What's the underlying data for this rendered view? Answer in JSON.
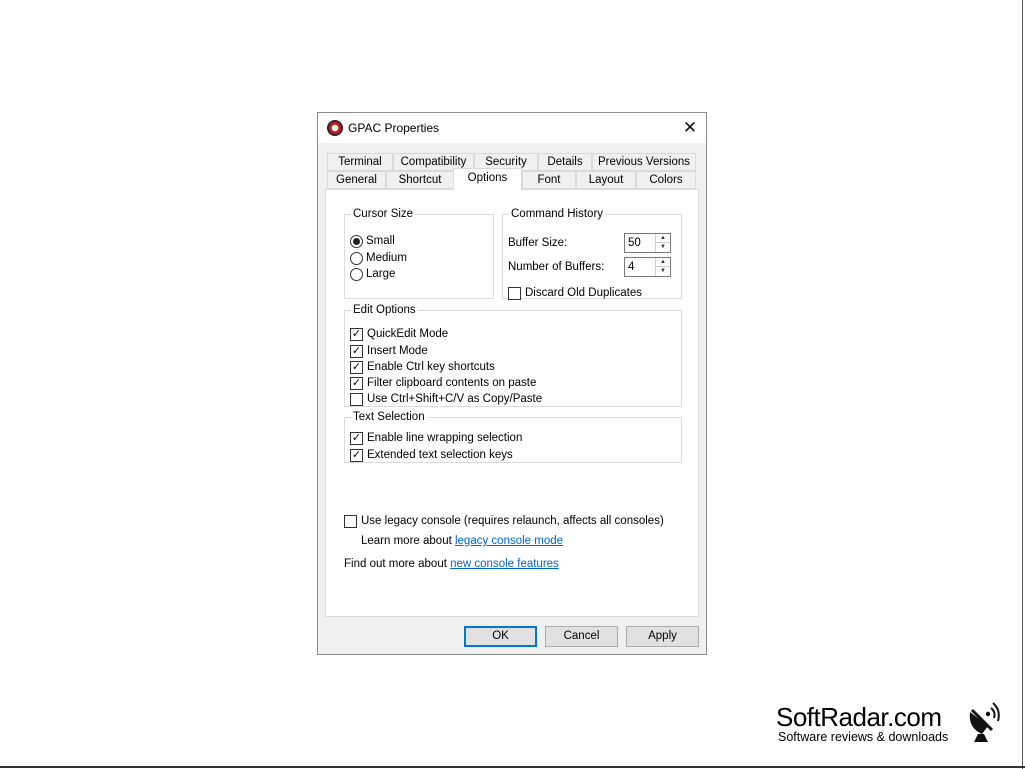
{
  "dialog": {
    "title": "GPAC Properties",
    "close_glyph": "✕"
  },
  "tabs": {
    "row1": [
      "Terminal",
      "Compatibility",
      "Security",
      "Details",
      "Previous Versions"
    ],
    "row2": [
      "General",
      "Shortcut",
      "Options",
      "Font",
      "Layout",
      "Colors"
    ],
    "active": "Options"
  },
  "cursor_size": {
    "legend": "Cursor Size",
    "options": [
      {
        "label": "Small",
        "selected": true
      },
      {
        "label": "Medium",
        "selected": false
      },
      {
        "label": "Large",
        "selected": false
      }
    ]
  },
  "command_history": {
    "legend": "Command History",
    "buffer_size_label": "Buffer Size:",
    "buffer_size_value": "50",
    "num_buffers_label": "Number of Buffers:",
    "num_buffers_value": "4",
    "discard_label": "Discard Old Duplicates",
    "discard_checked": false
  },
  "edit_options": {
    "legend": "Edit Options",
    "items": [
      {
        "label": "QuickEdit Mode",
        "checked": true
      },
      {
        "label": "Insert Mode",
        "checked": true
      },
      {
        "label": "Enable Ctrl key shortcuts",
        "checked": true
      },
      {
        "label": "Filter clipboard contents on paste",
        "checked": true
      },
      {
        "label": "Use Ctrl+Shift+C/V as Copy/Paste",
        "checked": false
      }
    ]
  },
  "text_selection": {
    "legend": "Text Selection",
    "items": [
      {
        "label": "Enable line wrapping selection",
        "checked": true
      },
      {
        "label": "Extended text selection keys",
        "checked": true
      }
    ]
  },
  "legacy": {
    "label": "Use legacy console (requires relaunch, affects all consoles)",
    "checked": false,
    "learn_more_prefix": "Learn more about ",
    "learn_more_link": "legacy console mode",
    "find_out_prefix": "Find out more about ",
    "find_out_link": "new console features"
  },
  "buttons": {
    "ok": "OK",
    "cancel": "Cancel",
    "apply": "Apply"
  },
  "branding": {
    "name": "SoftRadar.com",
    "tagline": "Software reviews & downloads"
  },
  "colors": {
    "accent": "#0078d7",
    "link": "#0066cc",
    "panel_bg": "#ffffff",
    "dialog_bg": "#f0f0f0"
  }
}
